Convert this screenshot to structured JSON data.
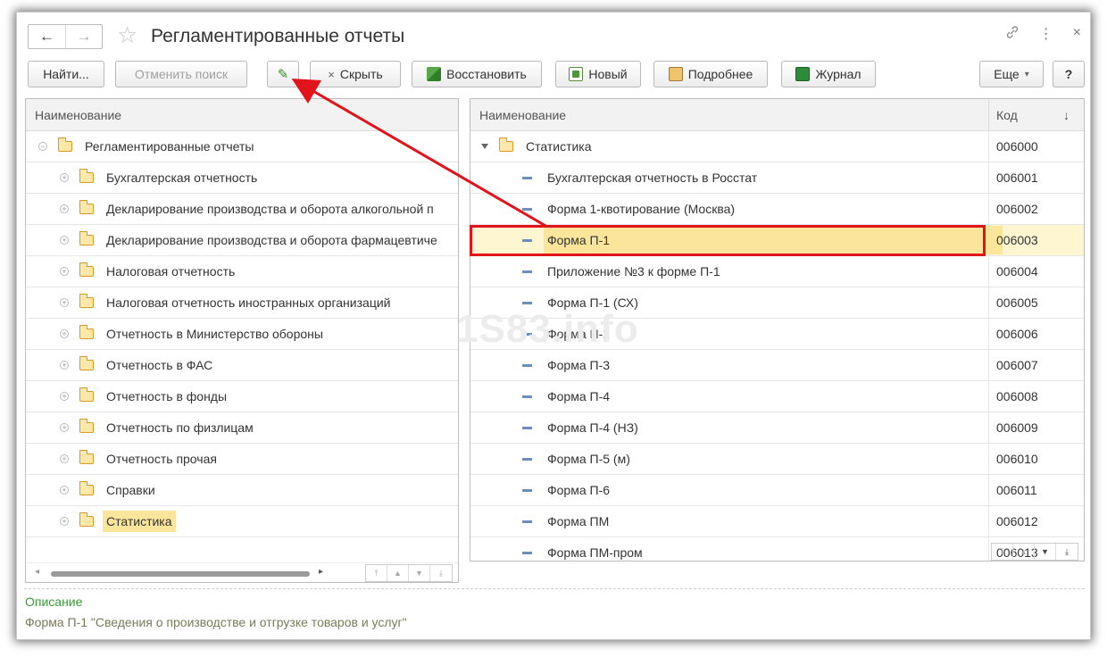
{
  "window": {
    "title": "Регламентированные отчеты",
    "back": "←",
    "forward": "→",
    "star": "☆",
    "link_icon": "🔗",
    "menu_icon": "⋮",
    "close_icon": "×"
  },
  "toolbar": {
    "find": "Найти...",
    "cancel_search": "Отменить поиск",
    "edit_icon": "✎",
    "hide": "Скрыть",
    "hide_prefix": "×",
    "restore": "Восстановить",
    "new": "Новый",
    "details": "Подробнее",
    "journal": "Журнал",
    "more": "Еще",
    "more_arrow": "▾",
    "help": "?"
  },
  "left_panel": {
    "header": "Наименование",
    "root": "Регламентированные отчеты",
    "items": [
      "Бухгалтерская отчетность",
      "Декларирование производства и оборота алкогольной п",
      "Декларирование производства и оборота фармацевтиче",
      "Налоговая отчетность",
      "Налоговая отчетность иностранных организаций",
      "Отчетность в Министерство обороны",
      "Отчетность в ФАС",
      "Отчетность в фонды",
      "Отчетность по физлицам",
      "Отчетность прочая",
      "Справки",
      "Статистика"
    ]
  },
  "right_panel": {
    "header_name": "Наименование",
    "header_code": "Код",
    "sort_icon": "↓",
    "group": {
      "name": "Статистика",
      "code": "006000"
    },
    "rows": [
      {
        "name": "Бухгалтерская отчетность в Росстат",
        "code": "006001"
      },
      {
        "name": "Форма 1-квотирование (Москва)",
        "code": "006002"
      },
      {
        "name": "Форма П-1",
        "code": "006003"
      },
      {
        "name": "Приложение №3 к форме П-1",
        "code": "006004"
      },
      {
        "name": "Форма П-1 (СХ)",
        "code": "006005"
      },
      {
        "name": "Форма П-2",
        "code": "006006"
      },
      {
        "name": "Форма П-3",
        "code": "006007"
      },
      {
        "name": "Форма П-4",
        "code": "006008"
      },
      {
        "name": "Форма П-4 (НЗ)",
        "code": "006009"
      },
      {
        "name": "Форма П-5 (м)",
        "code": "006010"
      },
      {
        "name": "Форма П-6",
        "code": "006011"
      },
      {
        "name": "Форма ПМ",
        "code": "006012"
      },
      {
        "name": "Форма ПМ-пром",
        "code": "006013"
      }
    ]
  },
  "description": {
    "label": "Описание",
    "text": "Форма П-1 \"Сведения о производстве и отгрузке товаров и услуг\""
  },
  "watermark": "1S83.info",
  "colors": {
    "highlight": "#e0141a",
    "selection": "#fbe59b",
    "description_label": "#3a9a3a"
  }
}
